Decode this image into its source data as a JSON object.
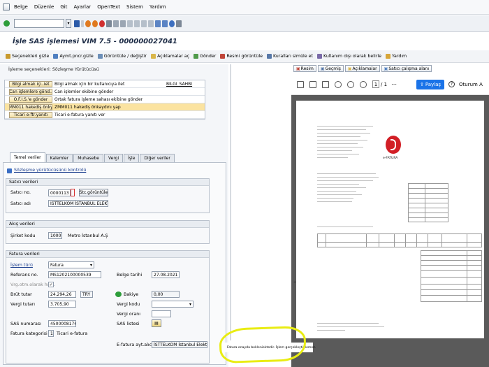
{
  "menubar": {
    "items": [
      "Belge",
      "Düzenle",
      "Git",
      "Ayarlar",
      "OpenText",
      "Sistem",
      "Yardım"
    ]
  },
  "systoolbar": {
    "command_value": ""
  },
  "title": "İşle SAS işlemesi VIM 7.5 - 000000027041",
  "apptoolbar": {
    "buttons": [
      "Seçenekleri gizle",
      "Aymt.pncr.gizle",
      "Görüntüle / değiştir",
      "Açıklamalar aç",
      "Gönder",
      "Resmi görüntüle",
      "Kuralları simüle et",
      "Kullanım dışı olarak belirle",
      "Yardım"
    ]
  },
  "process_options": {
    "header": "İşleme seçenekleri: Sözleşme Yürütücüsü",
    "rows": [
      {
        "button": "Bilgi almak içi..iet",
        "desc": "Bilgi almak için bir kullanıcıya ilet",
        "code": "BILGI_SAHBI"
      },
      {
        "button": "Can işlemlere gönd..",
        "desc": "Can işlemler ekibine gönder",
        "code": ""
      },
      {
        "button": "O.F.I.S.'e gönder",
        "desc": "Ortak fatura işleme sahası ekibine gönder",
        "code": ""
      },
      {
        "button": "ZMM011 hakediş önkyd",
        "desc": "ZMM011 hakediş önkaydını yap",
        "code": ""
      },
      {
        "button": "Ticari e-ftr.yanıtı",
        "desc": "Ticari e-fatura yanıtı ver",
        "code": ""
      }
    ],
    "selected_index": 3
  },
  "tabs": [
    "Temel veriler",
    "Kalemler",
    "Muhasebe",
    "Vergi",
    "İşle",
    "Diğer veriler"
  ],
  "link_text": "Sözleşme yürütücüsünü kontrolü",
  "vendor": {
    "header": "Satıcı verileri",
    "no_label": "Satıcı no.",
    "no_value": "0000113",
    "show_button": "Stc.görüntüle",
    "name_label": "Satıcı adı",
    "name_value": "ISTTELKOM İSTANBUL ELEKTRONİK .."
  },
  "company": {
    "header": "Akış verileri",
    "code_label": "Şirket kodu",
    "code_value": "1000",
    "code_text": "Metro İstanbul A.Ş"
  },
  "invoice": {
    "header": "Fatura verileri",
    "type_label": "İşlem türü",
    "type_value": "Fatura",
    "ref_label": "Referans no.",
    "ref_value": "MS1202100000539",
    "date_label": "Belge tarihi",
    "date_value": "27.08.2021",
    "calc_label": "Vrg.otm.olarak hspl.",
    "gross_label": "Brüt tutar",
    "gross_value": "24.294,26",
    "currency": "TRY",
    "balance_label": "Bakiye",
    "balance_value": "0,00",
    "tax_label": "Vergi tutarı",
    "tax_value": "3.705,90",
    "taxcode_label": "Vergi kodu",
    "taxrate_label": "Vergi oranı",
    "sas_label": "SAS numarası",
    "sas_value": "4500008176",
    "saslist_label": "SAS listesi",
    "cat_label": "Fatura kategorisi",
    "cat_value": "1",
    "cat_text": "Ticari e-fatura",
    "recipient_label": "E-fatura ayt.alıcısı",
    "recipient_value": "İSTTELKOM İstanbul Elektronik.."
  },
  "viewer": {
    "buttons": [
      "Resim",
      "Geçmiş",
      "Açıklamalar",
      "Satıcı çalışma alanı"
    ],
    "page_current": "1",
    "page_total": "/ 1",
    "share_label": "Paylaş",
    "signin_label": "Oturum A",
    "logo_text": "e-FATURA"
  },
  "status_message": "Fatura onayda bekleniektedir. İşlem gerçekleştirilemez.",
  "colors": {
    "selected_row": "#fbe3a0",
    "share_button": "#1a73e8",
    "highlight": "#e9ec12",
    "logo_red": "#d21f26"
  }
}
